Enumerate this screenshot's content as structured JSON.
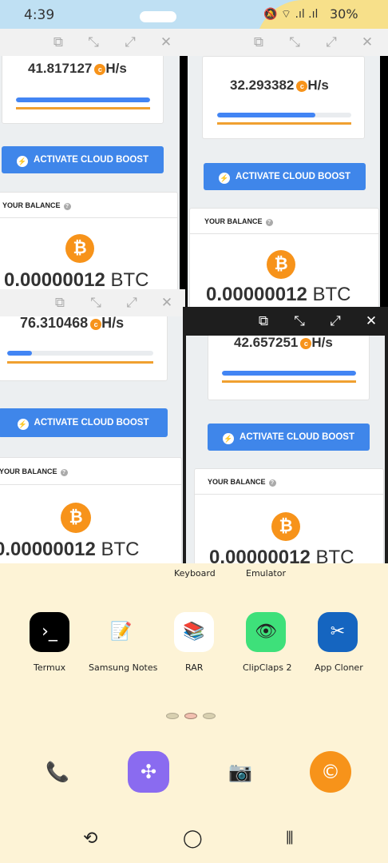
{
  "status_bar": {
    "time": "4:39",
    "icons": "🔕 ⌔ .ıl .ıl",
    "battery": "30%"
  },
  "window_controls": {
    "pip": "⧉",
    "minimize": "⤡",
    "expand": "⤢",
    "close": "✕"
  },
  "windows": [
    {
      "hashrate": "41.817127",
      "unit": "H/s",
      "progress": 1.0,
      "boost_label": "ACTIVATE CLOUD BOOST",
      "balance_title": "YOUR BALANCE",
      "btc_symbol": "₿",
      "balance_number": "0.00000012",
      "balance_unit": "BTC"
    },
    {
      "hashrate": "32.293382",
      "unit": "H/s",
      "progress": 0.73,
      "boost_label": "ACTIVATE CLOUD BOOST",
      "balance_title": "YOUR BALANCE",
      "btc_symbol": "₿",
      "balance_number": "0.00000012",
      "balance_unit": "BTC"
    },
    {
      "hashrate": "76.310468",
      "unit": "H/s",
      "progress": 0.17,
      "boost_label": "ACTIVATE CLOUD BOOST",
      "balance_title": "YOUR BALANCE",
      "btc_symbol": "₿",
      "balance_number": "0.00000012",
      "balance_unit": "BTC"
    },
    {
      "hashrate": "42.657251",
      "unit": "H/s",
      "progress": 1.0,
      "boost_label": "ACTIVATE CLOUD BOOST",
      "balance_title": "YOUR BALANCE",
      "btc_symbol": "₿",
      "balance_number": "0.00000012",
      "balance_unit": "BTC"
    }
  ],
  "home": {
    "partial_labels": [
      "Keyboard",
      "Emulator"
    ],
    "apps": [
      {
        "name": "Termux",
        "icon": "terminal-icon",
        "glyph": "›_",
        "bg": "#000000",
        "fg": "#ffffff"
      },
      {
        "name": "Samsung Notes",
        "icon": "notes-icon",
        "glyph": "📝",
        "bg": "transparent",
        "fg": "#222222"
      },
      {
        "name": "RAR",
        "icon": "rar-books-icon",
        "glyph": "📚",
        "bg": "#ffffff",
        "fg": "#c03030"
      },
      {
        "name": "ClipClaps 2",
        "icon": "clipclaps-icon",
        "glyph": "👁",
        "bg": "#3ee07a",
        "fg": "#222222"
      },
      {
        "name": "App Cloner",
        "icon": "app-cloner-icon",
        "glyph": "✂",
        "bg": "#1565c0",
        "fg": "#ffffff"
      }
    ],
    "dock": [
      {
        "icon": "fan-phone-icon",
        "glyph": "📞",
        "bg": "transparent",
        "fg": "#7a4a2a"
      },
      {
        "icon": "apps-grid-icon",
        "glyph": "✣",
        "bg": "#8a6bf0",
        "fg": "#ffffff"
      },
      {
        "icon": "camera-icon",
        "glyph": "📷",
        "bg": "transparent",
        "fg": "#5a3a2a"
      },
      {
        "icon": "coin-c-icon",
        "glyph": "©",
        "bg": "#f7931a",
        "fg": "#ffffff"
      }
    ],
    "nav": {
      "back": "⟲",
      "home": "◯",
      "recents": "⦀"
    }
  }
}
